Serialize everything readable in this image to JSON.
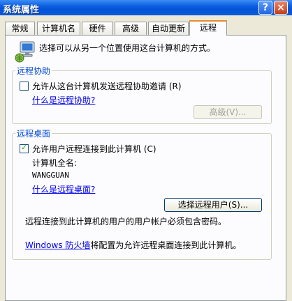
{
  "window": {
    "title": "系统属性",
    "help_glyph": "?",
    "close_glyph": "×"
  },
  "tabs": [
    {
      "label": "常规"
    },
    {
      "label": "计算机名"
    },
    {
      "label": "硬件"
    },
    {
      "label": "高级"
    },
    {
      "label": "自动更新"
    },
    {
      "label": "远程",
      "active": true
    }
  ],
  "intro": {
    "icon": "computer-network-icon",
    "text": "选择可以从另一个位置使用这台计算机的方式。"
  },
  "remote_assistance": {
    "group_title": "远程协助",
    "checkbox_label": "允许从这台计算机发送远程协助邀请",
    "checkbox_hotkey": "(R)",
    "checked": false,
    "help_link": "什么是远程协助?",
    "advanced_button": "高级(V)..."
  },
  "remote_desktop": {
    "group_title": "远程桌面",
    "checkbox_label": "允许用户远程连接到此计算机",
    "checkbox_hotkey": "(C)",
    "checked": true,
    "computer_name_label": "计算机全名:",
    "computer_name_value": "WANGGUAN",
    "help_link": "什么是远程桌面?",
    "select_users_button": "选择远程用户(S)...",
    "password_note": "远程连接到此计算机的用户的用户帐户必须包含密码。",
    "firewall_link": "Windows 防火墙",
    "firewall_text": "将配置为允许远程桌面连接到此计算机。"
  },
  "colors": {
    "group_title": "#0046d5",
    "link": "#0000ee",
    "tab_active_accent": "#e68b2c"
  }
}
